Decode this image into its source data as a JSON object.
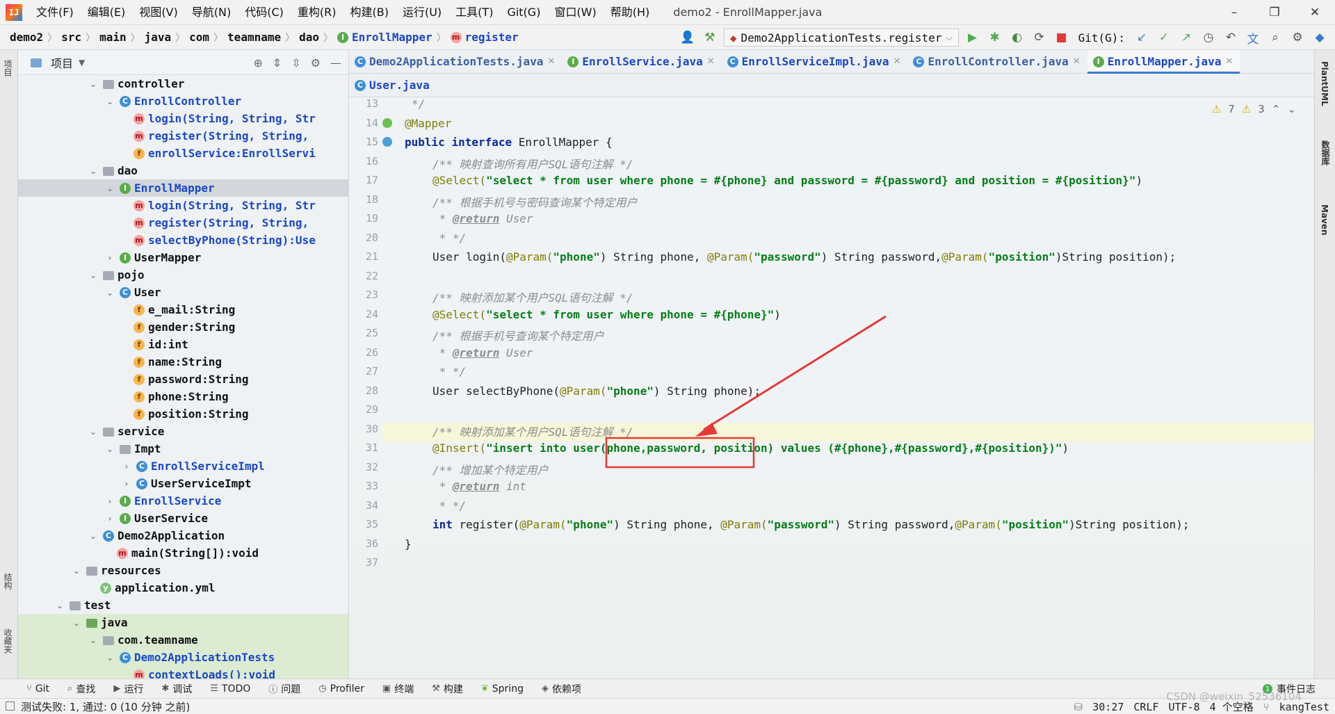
{
  "menu": {
    "items": [
      "文件(F)",
      "编辑(E)",
      "视图(V)",
      "导航(N)",
      "代码(C)",
      "重构(R)",
      "构建(B)",
      "运行(U)",
      "工具(T)",
      "Git(G)",
      "窗口(W)",
      "帮助(H)"
    ],
    "window_title": "demo2 - EnrollMapper.java",
    "minimize": "–",
    "restore": "❐",
    "close": "✕"
  },
  "breadcrumb": [
    "demo2",
    "src",
    "main",
    "java",
    "com",
    "teamname",
    "dao",
    "EnrollMapper",
    "register"
  ],
  "toolbar": {
    "run_config": "Demo2ApplicationTests.register",
    "git_label": "Git(G):"
  },
  "project": {
    "title": "项目",
    "tree": [
      {
        "label": "controller",
        "type": "folder"
      },
      {
        "label": "EnrollController",
        "type": "class"
      },
      {
        "label": "login(String, String, Str",
        "type": "method"
      },
      {
        "label": "register(String, String,",
        "type": "method"
      },
      {
        "label": "enrollService:EnrollServi",
        "type": "field"
      },
      {
        "label": "dao",
        "type": "folder"
      },
      {
        "label": "EnrollMapper",
        "type": "interface"
      },
      {
        "label": "login(String, String, Str",
        "type": "method"
      },
      {
        "label": "register(String, String,",
        "type": "method"
      },
      {
        "label": "selectByPhone(String):Use",
        "type": "method"
      },
      {
        "label": "UserMapper",
        "type": "interface"
      },
      {
        "label": "pojo",
        "type": "folder"
      },
      {
        "label": "User",
        "type": "class"
      },
      {
        "label": "e_mail:String",
        "type": "field"
      },
      {
        "label": "gender:String",
        "type": "field"
      },
      {
        "label": "id:int",
        "type": "field"
      },
      {
        "label": "name:String",
        "type": "field"
      },
      {
        "label": "password:String",
        "type": "field"
      },
      {
        "label": "phone:String",
        "type": "field"
      },
      {
        "label": "position:String",
        "type": "field"
      },
      {
        "label": "service",
        "type": "folder"
      },
      {
        "label": "Impt",
        "type": "folder"
      },
      {
        "label": "EnrollServiceImpl",
        "type": "class"
      },
      {
        "label": "UserServiceImpt",
        "type": "class"
      },
      {
        "label": "EnrollService",
        "type": "interface"
      },
      {
        "label": "UserService",
        "type": "interface"
      },
      {
        "label": "Demo2Application",
        "type": "class"
      },
      {
        "label": "main(String[]):void",
        "type": "method"
      },
      {
        "label": "resources",
        "type": "folder"
      },
      {
        "label": "application.yml",
        "type": "file"
      },
      {
        "label": "test",
        "type": "folder"
      },
      {
        "label": "java",
        "type": "folder"
      },
      {
        "label": "com.teamname",
        "type": "folder"
      },
      {
        "label": "Demo2ApplicationTests",
        "type": "class"
      },
      {
        "label": "contextLoads():void",
        "type": "method"
      }
    ]
  },
  "tabs": {
    "row1": [
      "Demo2ApplicationTests.java",
      "EnrollService.java",
      "EnrollServiceImpl.java",
      "EnrollController.java",
      "EnrollMapper.java"
    ],
    "row2": [
      "User.java"
    ],
    "active": "EnrollMapper.java"
  },
  "editor": {
    "warnings": "7",
    "weak_warnings": "3",
    "line_numbers": [
      "13",
      "14",
      "15",
      "16",
      "17",
      "18",
      "19",
      "20",
      "21",
      "22",
      "23",
      "24",
      "25",
      "26",
      "27",
      "28",
      "29",
      "30",
      "31",
      "32",
      "33",
      "34",
      "35",
      "36",
      "37"
    ],
    "lines": {
      "l13": "*/",
      "l14": "@Mapper",
      "l15_kw1": "public",
      "l15_kw2": "interface",
      "l15_rest": "EnrollMapper {",
      "l16": "/** 映射查询所有用户SQL语句注解 */",
      "l17_ann": "@Select(",
      "l17_str": "\"select * from user where phone = #{phone} and password = #{password} and position = #{position}\"",
      "l17_end": ")",
      "l18": "/** 根据手机号与密码查询某个特定用户",
      "l19_pre": " * ",
      "l19_tag": "@return",
      "l19_post": " User",
      "l20": " * */",
      "l21_a": "User login(",
      "l21_b": "@Param(",
      "l21_c": "\"phone\"",
      "l21_d": ") String phone, ",
      "l21_e": "@Param(",
      "l21_f": "\"password\"",
      "l21_g": ") String password,",
      "l21_h": "@Param(",
      "l21_i": "\"position\"",
      "l21_j": ")String position);",
      "l23": "/** 映射添加某个用户SQL语句注解 */",
      "l24_ann": "@Select(",
      "l24_str": "\"select * from user where phone = #{phone}\"",
      "l24_end": ")",
      "l25": "/** 根据手机号查询某个特定用户",
      "l26_pre": " * ",
      "l26_tag": "@return",
      "l26_post": " User",
      "l27": " * */",
      "l28_a": "User selectByPhone(",
      "l28_b": "@Param(",
      "l28_c": "\"phone\"",
      "l28_d": ") String phone);",
      "l30": "/** 映射添加某个用户SQL语句注解 */",
      "l31_ann": "@Insert(",
      "l31_str": "\"insert into user(phone,password, position) values (#{phone},#{password},#{position})\"",
      "l31_end": ")",
      "l32": "/** 增加某个特定用户",
      "l33_pre": " * ",
      "l33_tag": "@return",
      "l33_post": " int",
      "l34": " * */",
      "l35_kw": "int",
      "l35_a": " register(",
      "l35_b": "@Param(",
      "l35_c": "\"phone\"",
      "l35_d": ") String phone, ",
      "l35_e": "@Param(",
      "l35_f": "\"password\"",
      "l35_g": ") String password,",
      "l35_h": "@Param(",
      "l35_i": "\"position\"",
      "l35_j": ")String position);",
      "l36": "}"
    }
  },
  "right_tools": [
    "PlantUML",
    "数据库",
    "Maven"
  ],
  "left_tools": [
    "项目",
    "结构",
    "收藏夹"
  ],
  "toolwindows": [
    "Git",
    "查找",
    "运行",
    "调试",
    "TODO",
    "问题",
    "Profiler",
    "终端",
    "构建",
    "Spring",
    "依赖项"
  ],
  "event_log": "事件日志",
  "status": {
    "message": "测试失败: 1, 通过: 0 (10 分钟 之前)",
    "position": "30:27",
    "line_sep": "CRLF",
    "encoding": "UTF-8",
    "indent": "4 个空格",
    "branch": "kangTest",
    "watermark": "CSDN @weixin_52536104"
  },
  "colors": {
    "highlight": "#e53935",
    "accent": "#3b78d8"
  }
}
